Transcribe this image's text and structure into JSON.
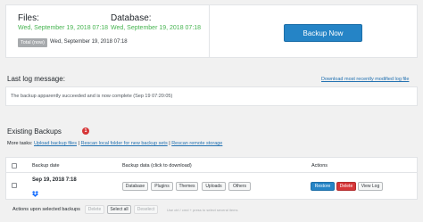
{
  "status": {
    "files_label": "Files:",
    "files_date": "Wed, September 19, 2018 07:18",
    "database_label": "Database:",
    "database_date": "Wed, September 19, 2018 07:18",
    "tag_label": "Total (now)",
    "tag_value": "Wed, September 19, 2018 07:18",
    "backup_now": "Backup Now"
  },
  "log": {
    "title": "Last log message:",
    "download_link": "Download most recently modified log file",
    "message": "The backup apparently succeeded and is now complete (Sep 19 07:20:05)"
  },
  "existing": {
    "title": "Existing Backups",
    "count": "1",
    "more_tasks_label": "More tasks:",
    "upload_link": "Upload backup files",
    "rescan_local": "Rescan local folder for new backup sets",
    "rescan_remote": "Rescan remote storage",
    "sep1": "|",
    "sep2": "|"
  },
  "table": {
    "headers": {
      "date": "Backup date",
      "data": "Backup data (click to download)",
      "actions": "Actions"
    },
    "row": {
      "date": "Sep 19, 2018 7:18",
      "data_buttons": [
        "Database",
        "Plugins",
        "Themes",
        "Uploads",
        "Others"
      ],
      "restore": "Restore",
      "delete": "Delete",
      "view_log": "View Log"
    }
  },
  "bulk": {
    "label": "Actions upon selected backups",
    "delete": "Delete",
    "select_all": "Select all",
    "deselect": "Deselect",
    "hint": "Use ctrl / cmd + press to select several items"
  }
}
